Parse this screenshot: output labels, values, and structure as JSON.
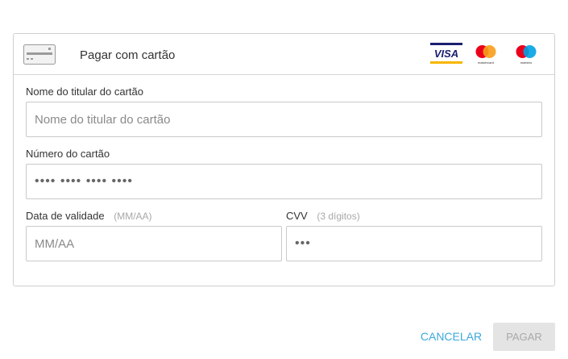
{
  "header": {
    "title": "Pagar com cartão",
    "card_icon": "credit-card-icon",
    "brands": {
      "visa": "VISA",
      "mastercard": "mastercard",
      "maestro": "maestro"
    }
  },
  "fields": {
    "name": {
      "label": "Nome do titular do cartão",
      "placeholder": "Nome do titular do cartão",
      "value": ""
    },
    "number": {
      "label": "Número do cartão",
      "placeholder": "•••• •••• •••• ••••",
      "value": ""
    },
    "expiry": {
      "label": "Data de validade",
      "hint": "(MM/AA)",
      "placeholder": "MM/AA",
      "value": ""
    },
    "cvv": {
      "label": "CVV",
      "hint": "(3 dígitos)",
      "placeholder": "•••",
      "value": ""
    }
  },
  "actions": {
    "cancel_label": "CANCELAR",
    "pay_label": "PAGAR",
    "pay_disabled": true
  },
  "colors": {
    "accent": "#3ba8dc",
    "visa_blue": "#1a1f71",
    "visa_gold": "#f7b600",
    "mc_red": "#eb001b",
    "mc_orange": "#f79e1b",
    "maestro_blue": "#00a2e5"
  }
}
